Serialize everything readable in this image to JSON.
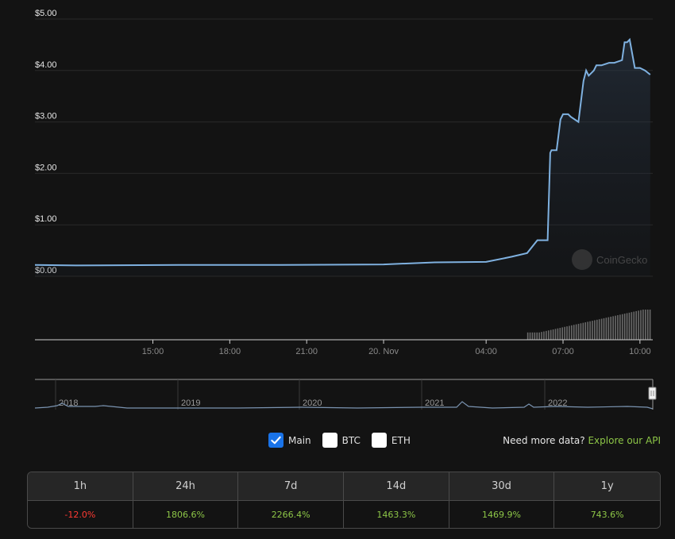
{
  "chart": {
    "watermark": "CoinGecko",
    "colors": {
      "line": "#7fb1e0",
      "volume": "#6a6a6a",
      "grid": "#2a2a2a",
      "background": "#131313"
    }
  },
  "chart_data": {
    "type": "area",
    "y_tick_labels": [
      "$5.00",
      "$4.00",
      "$3.00",
      "$2.00",
      "$1.00",
      "$0.00"
    ],
    "ylim": [
      0,
      5
    ],
    "x_tick_labels": [
      "15:00",
      "18:00",
      "21:00",
      "20. Nov",
      "04:00",
      "07:00",
      "10:00"
    ],
    "x_hours": [
      3,
      6,
      9,
      12,
      16,
      19,
      22
    ],
    "xlim": [
      -1.6,
      22.5
    ],
    "series": [
      {
        "values_x_hours": [
          -1.6,
          0,
          4,
          8,
          12,
          14,
          16,
          17,
          17.6,
          18,
          18.4,
          18.5,
          18.55,
          18.7,
          18.75,
          18.9,
          19.0,
          19.2,
          19.3,
          19.6,
          19.8,
          19.85,
          19.9,
          20.0,
          20.2,
          20.3,
          20.5,
          20.8,
          21.0,
          21.3,
          21.4,
          21.5,
          21.6,
          21.8,
          22.0,
          22.2,
          22.4
        ],
        "values_usd": [
          0.22,
          0.21,
          0.22,
          0.22,
          0.23,
          0.27,
          0.28,
          0.38,
          0.45,
          0.7,
          0.7,
          2.4,
          2.45,
          2.45,
          2.45,
          3.05,
          3.15,
          3.15,
          3.1,
          3.0,
          3.8,
          3.9,
          4.0,
          3.9,
          4.0,
          4.1,
          4.1,
          4.15,
          4.15,
          4.2,
          4.55,
          4.55,
          4.6,
          4.05,
          4.05,
          4.0,
          3.92
        ]
      }
    ],
    "volume_relative": "increasing after 18:00"
  },
  "navigator": {
    "labels": [
      "2018",
      "2019",
      "2020",
      "2021",
      "2022"
    ]
  },
  "series_toggles": [
    {
      "label": "Main",
      "checked": true
    },
    {
      "label": "BTC",
      "checked": false
    },
    {
      "label": "ETH",
      "checked": false
    }
  ],
  "more_data": {
    "text": "Need more data?",
    "link": "Explore our API"
  },
  "performance": {
    "headers": [
      "1h",
      "24h",
      "7d",
      "14d",
      "30d",
      "1y"
    ],
    "values": [
      "-12.0%",
      "1806.6%",
      "2266.4%",
      "1463.3%",
      "1469.9%",
      "743.6%"
    ]
  }
}
